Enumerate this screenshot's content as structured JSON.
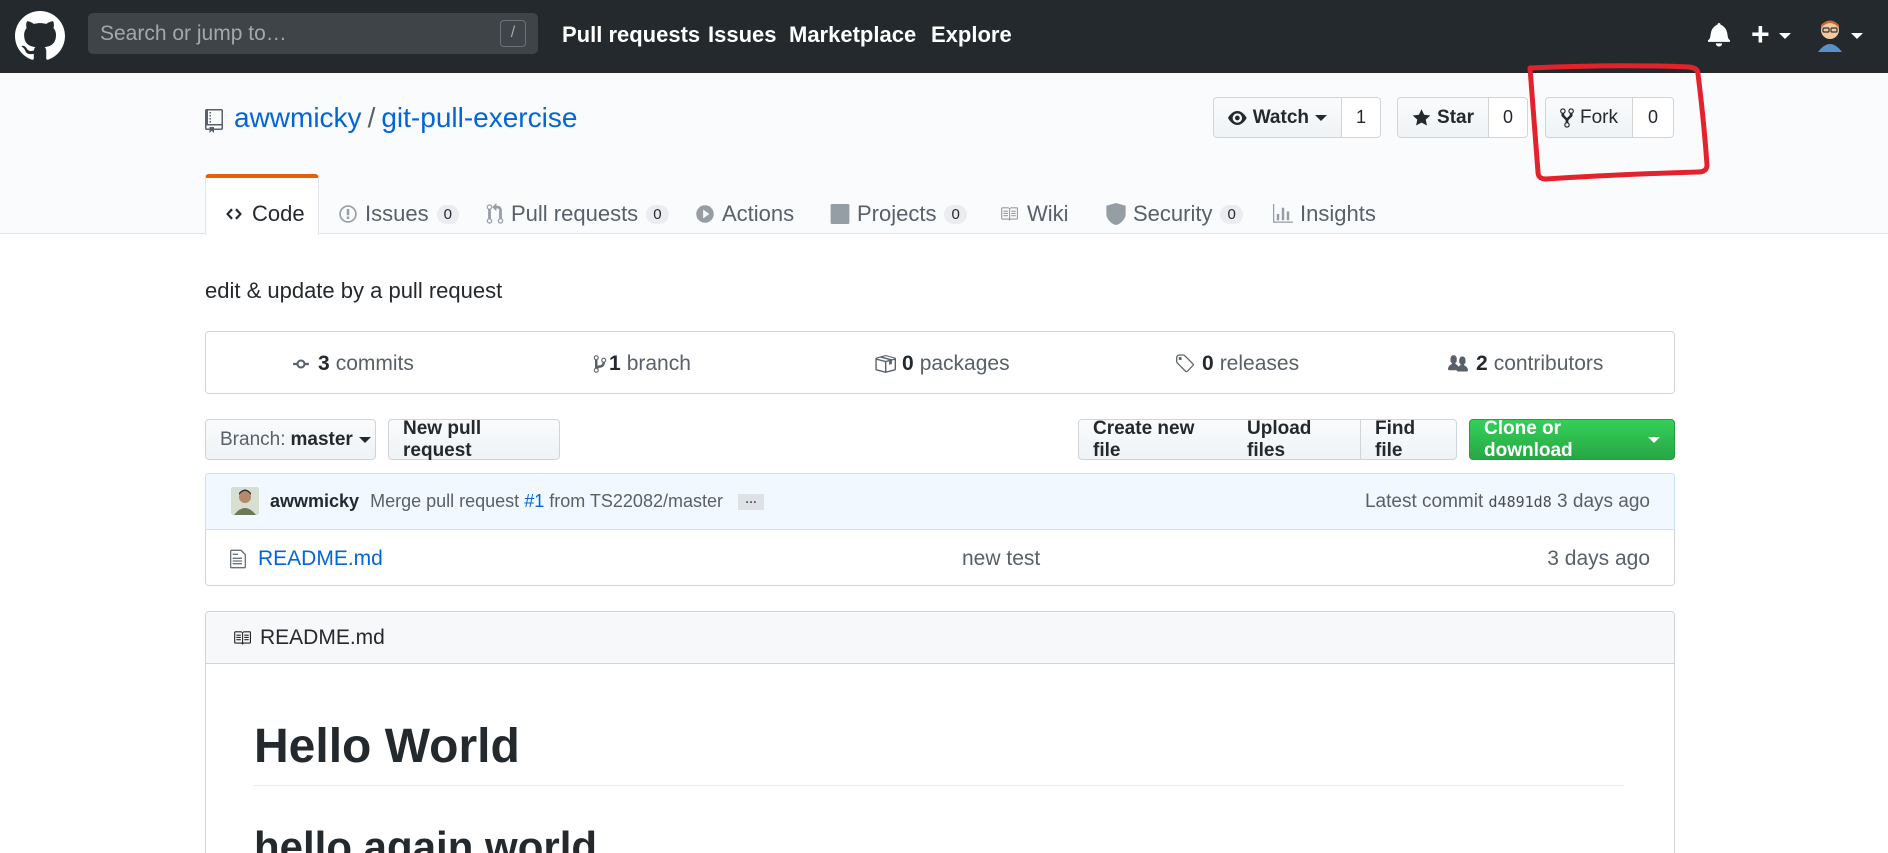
{
  "header": {
    "search_placeholder": "Search or jump to…",
    "search_shortcut": "/",
    "nav": [
      "Pull requests",
      "Issues",
      "Marketplace",
      "Explore"
    ]
  },
  "repo": {
    "owner": "awwmicky",
    "separator": "/",
    "name": "git-pull-exercise",
    "watch_label": "Watch",
    "watch_count": "1",
    "star_label": "Star",
    "star_count": "0",
    "fork_label": "Fork",
    "fork_count": "0"
  },
  "tabs": {
    "code": "Code",
    "issues": {
      "label": "Issues",
      "count": "0"
    },
    "pulls": {
      "label": "Pull requests",
      "count": "0"
    },
    "actions": "Actions",
    "projects": {
      "label": "Projects",
      "count": "0"
    },
    "wiki": "Wiki",
    "security": {
      "label": "Security",
      "count": "0"
    },
    "insights": "Insights"
  },
  "description": "edit & update by a pull request",
  "summary": {
    "commits": {
      "num": "3",
      "label": "commits"
    },
    "branches": {
      "num": "1",
      "label": "branch"
    },
    "packages": {
      "num": "0",
      "label": "packages"
    },
    "releases": {
      "num": "0",
      "label": "releases"
    },
    "contributors": {
      "num": "2",
      "label": "contributors"
    }
  },
  "filenav": {
    "branch_prefix": "Branch:",
    "branch_name": "master",
    "new_pr": "New pull request",
    "create_file": "Create new file",
    "upload_files": "Upload files",
    "find_file": "Find file",
    "clone": "Clone or download"
  },
  "commit": {
    "author": "awwmicky",
    "message_prefix": "Merge pull request",
    "pr_link": "#1",
    "message_suffix": "from TS22082/master",
    "ellipsis": "…",
    "latest_label": "Latest commit",
    "sha": "d4891d8",
    "age": "3 days ago"
  },
  "files": [
    {
      "name": "README.md",
      "message": "new test",
      "age": "3 days ago"
    }
  ],
  "readme": {
    "header": "README.md",
    "h1": "Hello World",
    "h2": "hello again world"
  },
  "colors": {
    "header_bg": "#24292e",
    "link": "#0366d6",
    "tab_accent": "#e36209",
    "clone_button": "#28a745",
    "annotation": "#e3232b"
  }
}
